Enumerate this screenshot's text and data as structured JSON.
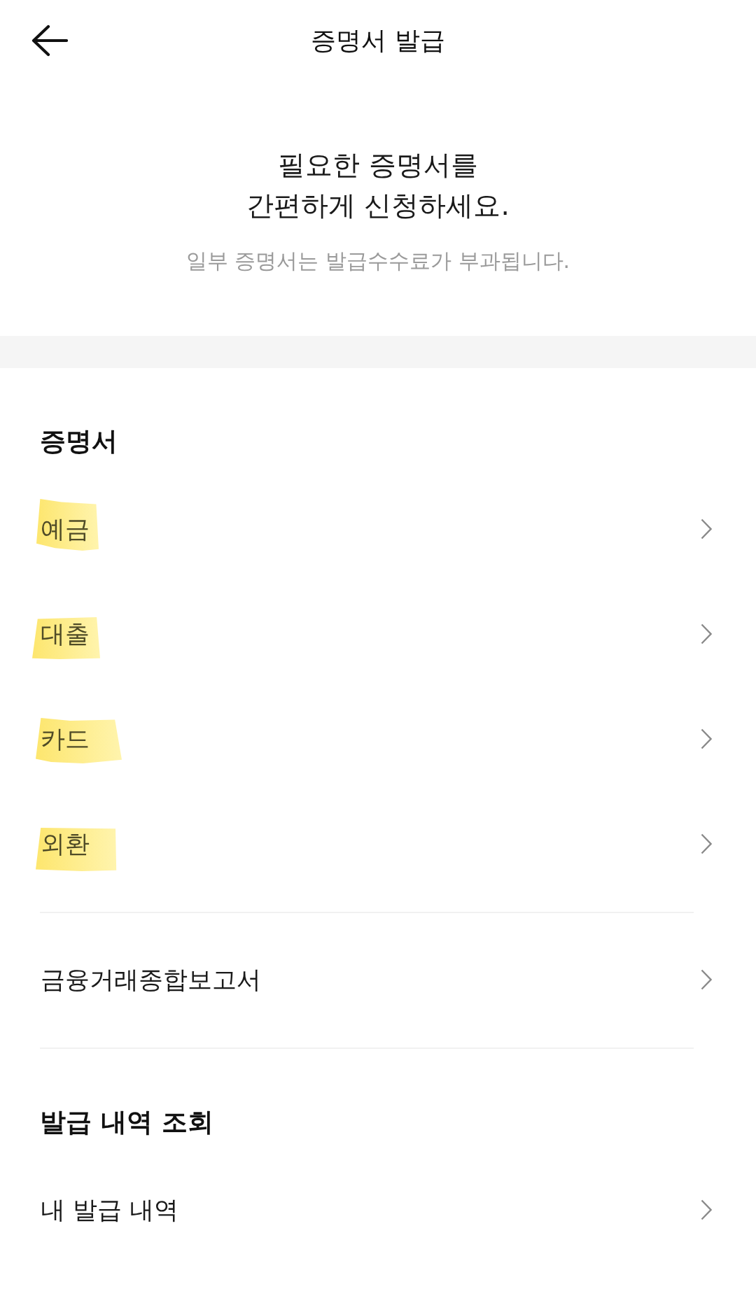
{
  "header": {
    "title": "증명서 발급"
  },
  "intro": {
    "headline": "필요한 증명서를\n간편하게 신청하세요.",
    "note": "일부 증명서는 발급수수료가 부과됩니다."
  },
  "sections": [
    {
      "title": "증명서",
      "items": [
        {
          "label": "예금",
          "highlighted": true
        },
        {
          "label": "대출",
          "highlighted": true
        },
        {
          "label": "카드",
          "highlighted": true
        },
        {
          "label": "외환",
          "highlighted": true
        }
      ]
    },
    {
      "items": [
        {
          "label": "금융거래종합보고서",
          "highlighted": false
        }
      ]
    },
    {
      "title": "발급 내역 조회",
      "items": [
        {
          "label": "내 발급 내역",
          "highlighted": false
        }
      ]
    }
  ]
}
